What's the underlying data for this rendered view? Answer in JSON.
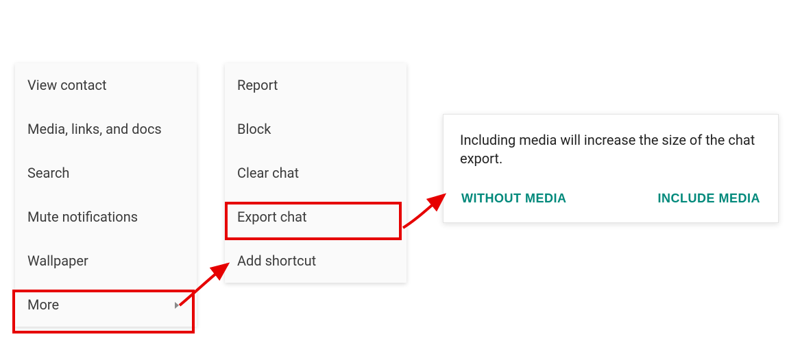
{
  "menu1": {
    "items": [
      {
        "label": "View contact"
      },
      {
        "label": "Media, links, and docs"
      },
      {
        "label": "Search"
      },
      {
        "label": "Mute notifications"
      },
      {
        "label": "Wallpaper"
      },
      {
        "label": "More"
      }
    ]
  },
  "menu2": {
    "items": [
      {
        "label": "Report"
      },
      {
        "label": "Block"
      },
      {
        "label": "Clear chat"
      },
      {
        "label": "Export chat"
      },
      {
        "label": "Add shortcut"
      }
    ]
  },
  "dialog": {
    "message": "Including media will increase the size of the chat export.",
    "without_label": "WITHOUT MEDIA",
    "include_label": "INCLUDE MEDIA"
  },
  "colors": {
    "highlight": "#e60000",
    "accent": "#00897b",
    "menu_bg": "#fafafa"
  }
}
